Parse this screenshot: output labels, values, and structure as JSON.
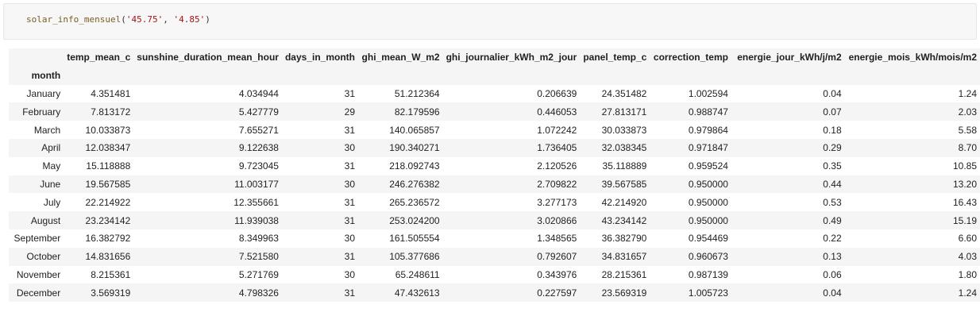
{
  "cell": {
    "function_name": "solar_info_mensuel",
    "arg1": "'45.75'",
    "arg2": "'4.85'"
  },
  "table": {
    "index_name": "month",
    "columns": [
      "temp_mean_c",
      "sunshine_duration_mean_hour",
      "days_in_month",
      "ghi_mean_W_m2",
      "ghi_journalier_kWh_m2_jour",
      "panel_temp_c",
      "correction_temp",
      "energie_jour_kWh/j/m2",
      "energie_mois_kWh/mois/m2"
    ],
    "rows": [
      {
        "month": "January",
        "values": [
          "4.351481",
          "4.034944",
          "31",
          "51.212364",
          "0.206639",
          "24.351482",
          "1.002594",
          "0.04",
          "1.24"
        ]
      },
      {
        "month": "February",
        "values": [
          "7.813172",
          "5.427779",
          "29",
          "82.179596",
          "0.446053",
          "27.813171",
          "0.988747",
          "0.07",
          "2.03"
        ]
      },
      {
        "month": "March",
        "values": [
          "10.033873",
          "7.655271",
          "31",
          "140.065857",
          "1.072242",
          "30.033873",
          "0.979864",
          "0.18",
          "5.58"
        ]
      },
      {
        "month": "April",
        "values": [
          "12.038347",
          "9.122638",
          "30",
          "190.340271",
          "1.736405",
          "32.038345",
          "0.971847",
          "0.29",
          "8.70"
        ]
      },
      {
        "month": "May",
        "values": [
          "15.118888",
          "9.723045",
          "31",
          "218.092743",
          "2.120526",
          "35.118889",
          "0.959524",
          "0.35",
          "10.85"
        ]
      },
      {
        "month": "June",
        "values": [
          "19.567585",
          "11.003177",
          "30",
          "246.276382",
          "2.709822",
          "39.567585",
          "0.950000",
          "0.44",
          "13.20"
        ]
      },
      {
        "month": "July",
        "values": [
          "22.214922",
          "12.355661",
          "31",
          "265.236572",
          "3.277173",
          "42.214920",
          "0.950000",
          "0.53",
          "16.43"
        ]
      },
      {
        "month": "August",
        "values": [
          "23.234142",
          "11.939038",
          "31",
          "253.024200",
          "3.020866",
          "43.234142",
          "0.950000",
          "0.49",
          "15.19"
        ]
      },
      {
        "month": "September",
        "values": [
          "16.382792",
          "8.349963",
          "30",
          "161.505554",
          "1.348565",
          "36.382790",
          "0.954469",
          "0.22",
          "6.60"
        ]
      },
      {
        "month": "October",
        "values": [
          "14.831656",
          "7.521580",
          "31",
          "105.377686",
          "0.792607",
          "34.831657",
          "0.960673",
          "0.13",
          "4.03"
        ]
      },
      {
        "month": "November",
        "values": [
          "8.215361",
          "5.271769",
          "30",
          "65.248611",
          "0.343976",
          "28.215361",
          "0.987139",
          "0.06",
          "1.80"
        ]
      },
      {
        "month": "December",
        "values": [
          "3.569319",
          "4.798326",
          "31",
          "47.432613",
          "0.227597",
          "23.569319",
          "1.005723",
          "0.04",
          "1.24"
        ]
      }
    ]
  }
}
